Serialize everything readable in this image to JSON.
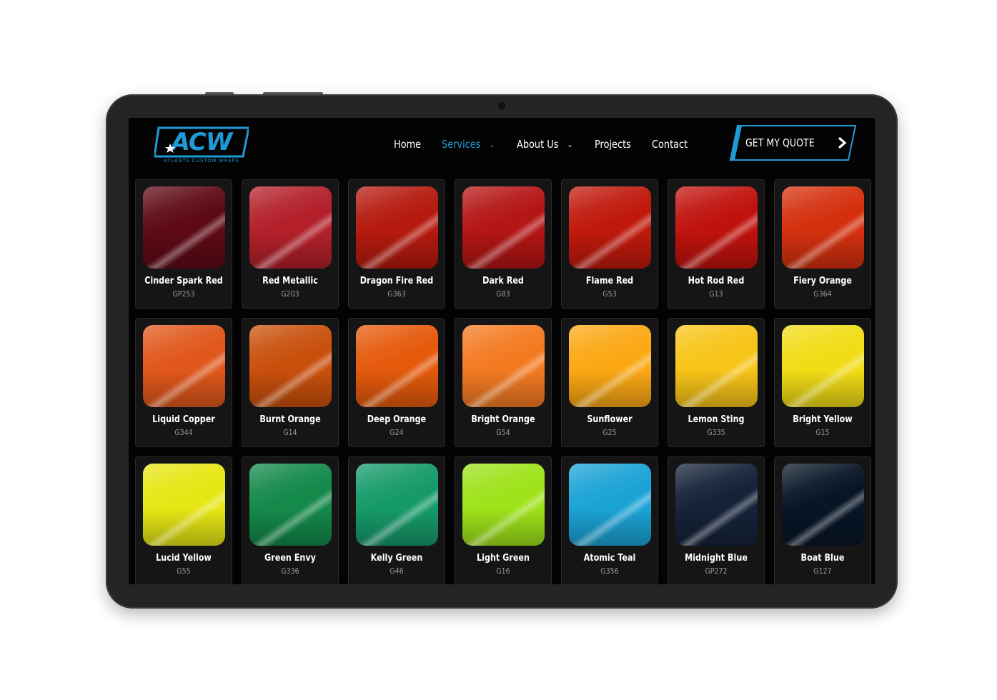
{
  "header": {
    "logo_text": "ACW",
    "logo_subtitle": "ATLANTA CUSTOM WRAPS",
    "nav": [
      {
        "label": "Home",
        "active": false,
        "dropdown": false
      },
      {
        "label": "Services",
        "active": true,
        "dropdown": true
      },
      {
        "label": "About Us",
        "active": false,
        "dropdown": true
      },
      {
        "label": "Projects",
        "active": false,
        "dropdown": false
      },
      {
        "label": "Contact",
        "active": false,
        "dropdown": false
      }
    ],
    "cta_label": "GET MY QUOTE",
    "cta_icon": "chevron-right-icon"
  },
  "colors": {
    "accent": "#1e9bd6",
    "screen_bg": "#030303",
    "card_bg": "#151515",
    "bezel": "#242424"
  },
  "swatches": [
    {
      "name": "Cinder Spark Red",
      "code": "GP253",
      "color": "#5e0a16"
    },
    {
      "name": "Red Metallic",
      "code": "G203",
      "color": "#b3202a"
    },
    {
      "name": "Dragon Fire Red",
      "code": "G363",
      "color": "#b51a0e"
    },
    {
      "name": "Dark Red",
      "code": "G83",
      "color": "#b41515"
    },
    {
      "name": "Flame Red",
      "code": "G53",
      "color": "#c0190c"
    },
    {
      "name": "Hot Rod Red",
      "code": "G13",
      "color": "#c0120d"
    },
    {
      "name": "Fiery Orange",
      "code": "G364",
      "color": "#d4300e"
    },
    {
      "name": "Liquid Copper",
      "code": "G344",
      "color": "#e0571c"
    },
    {
      "name": "Burnt Orange",
      "code": "G14",
      "color": "#c9500c"
    },
    {
      "name": "Deep Orange",
      "code": "G24",
      "color": "#e55a0c"
    },
    {
      "name": "Bright Orange",
      "code": "G54",
      "color": "#f47a22"
    },
    {
      "name": "Sunflower",
      "code": "G25",
      "color": "#fba814"
    },
    {
      "name": "Lemon Sting",
      "code": "G335",
      "color": "#f7c418"
    },
    {
      "name": "Bright Yellow",
      "code": "G15",
      "color": "#f1dc16"
    },
    {
      "name": "Lucid Yellow",
      "code": "G55",
      "color": "#e6e614"
    },
    {
      "name": "Green Envy",
      "code": "G336",
      "color": "#13894a"
    },
    {
      "name": "Kelly Green",
      "code": "G46",
      "color": "#169a6a"
    },
    {
      "name": "Light Green",
      "code": "G16",
      "color": "#9ee21a"
    },
    {
      "name": "Atomic Teal",
      "code": "G356",
      "color": "#1ba3d6"
    },
    {
      "name": "Midnight Blue",
      "code": "GP272",
      "color": "#152238"
    },
    {
      "name": "Boat Blue",
      "code": "G127",
      "color": "#081526"
    }
  ]
}
